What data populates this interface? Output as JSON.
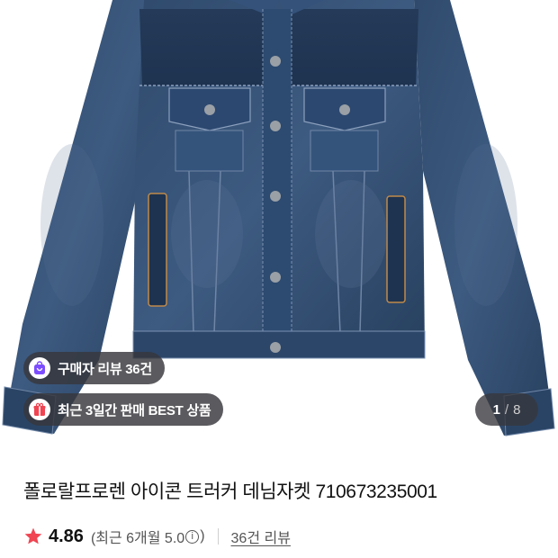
{
  "product": {
    "image_alt": "denim-jacket-photo",
    "badges": [
      {
        "icon": "shopping-bag-icon",
        "label": "구매자 리뷰 36건",
        "icon_color": "#7c4dff"
      },
      {
        "icon": "gift-icon",
        "label": "최근 3일간 판매 BEST 상품",
        "icon_color": "#f04452"
      }
    ],
    "gallery": {
      "current": "1",
      "separator": "/",
      "total": "8"
    },
    "title": "폴로랄프로렌 아이콘 트러커 데님자켓 710673235001",
    "rating": {
      "score": "4.86",
      "recent_open": "(최근 6개월 5.0",
      "recent_close": ")",
      "info_icon": "ⓘ",
      "reviews_link": "36건 리뷰",
      "star_color": "#f04452"
    }
  }
}
